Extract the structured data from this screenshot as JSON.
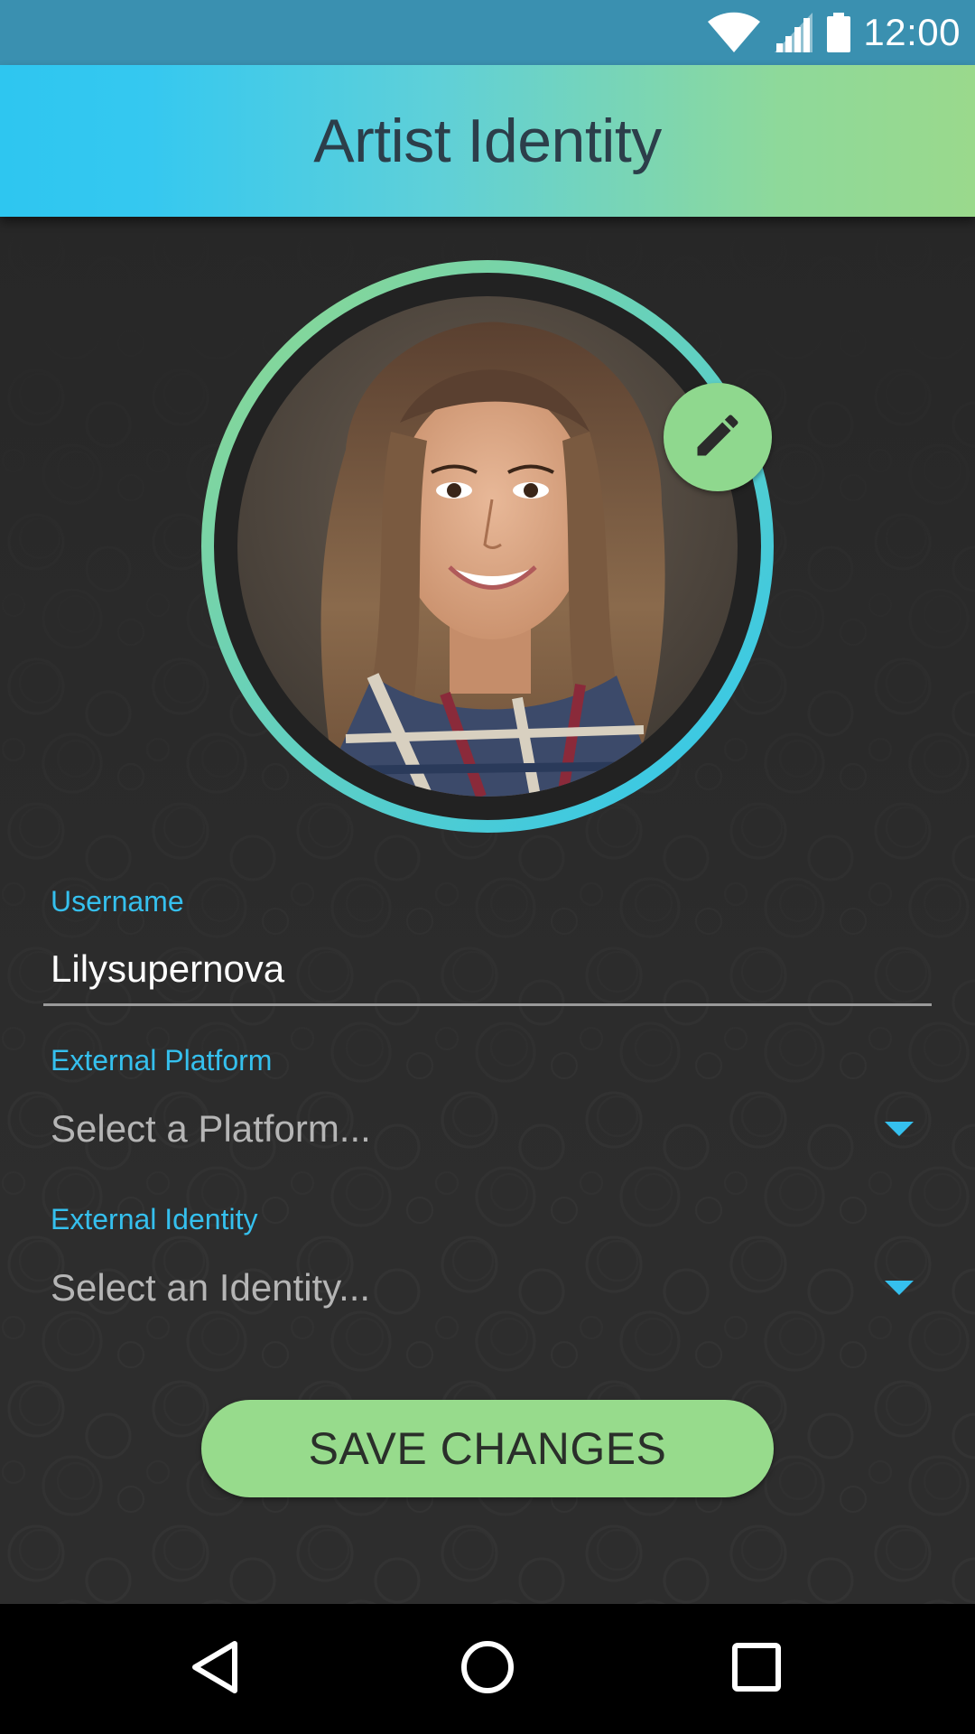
{
  "status_bar": {
    "time": "12:00",
    "icons": [
      "wifi-icon",
      "signal-icon",
      "battery-icon"
    ]
  },
  "app_bar": {
    "title": "Artist Identity"
  },
  "profile": {
    "photo_alt": "Profile photo",
    "edit_icon": "pencil-icon"
  },
  "form": {
    "username": {
      "label": "Username",
      "value": "Lilysupernova"
    },
    "external_platform": {
      "label": "External Platform",
      "placeholder": "Select a Platform..."
    },
    "external_identity": {
      "label": "External Identity",
      "placeholder": "Select an Identity..."
    },
    "save_label": "SAVE CHANGES"
  },
  "nav_bar": {
    "icons": [
      "back-icon",
      "home-icon",
      "recents-icon"
    ]
  },
  "colors": {
    "status_bar": "#3a90b0",
    "accent_blue": "#35c0ee",
    "accent_green": "#97db8c",
    "background": "#272727"
  }
}
